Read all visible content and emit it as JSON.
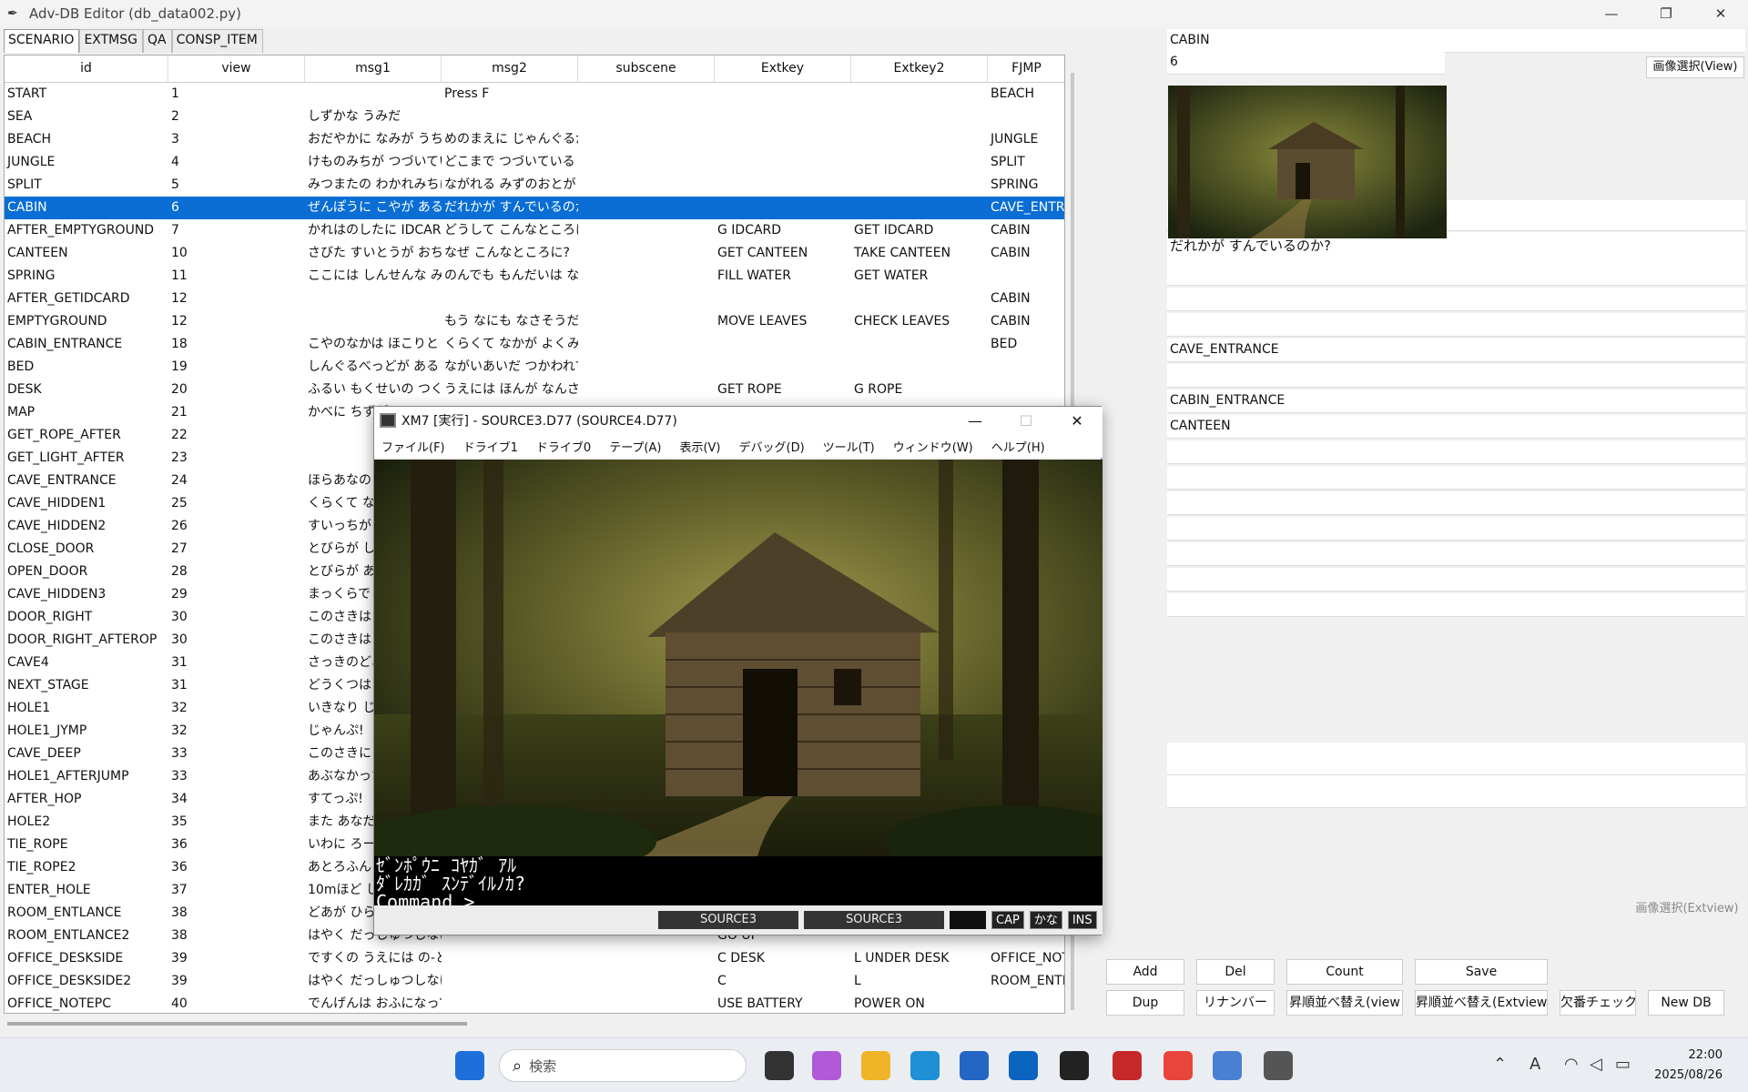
{
  "window": {
    "title": "Adv-DB Editor  (db_data002.py)",
    "minimize": "—",
    "restore": "❐",
    "close": "✕"
  },
  "tabs": [
    "SCENARIO",
    "EXTMSG",
    "QA",
    "CONSP_ITEM"
  ],
  "columns": [
    "id",
    "view",
    "msg1",
    "msg2",
    "subscene",
    "Extkey",
    "Extkey2",
    "FJMP"
  ],
  "rows": [
    [
      "START",
      "1",
      "",
      "Press F",
      "",
      "",
      "",
      "BEACH"
    ],
    [
      "SEA",
      "2",
      "しずかな うみだ",
      "",
      "",
      "",
      "",
      ""
    ],
    [
      "BEACH",
      "3",
      "おだやかに なみが うちよ",
      "めのまえに じゃんぐるが",
      "",
      "",
      "",
      "JUNGLE"
    ],
    [
      "JUNGLE",
      "4",
      "けものみちが つづいてい",
      "どこまで つづいている の",
      "",
      "",
      "",
      "SPLIT"
    ],
    [
      "SPLIT",
      "5",
      "みつまたの わかれみちに",
      "ながれる みずのおとが き",
      "",
      "",
      "",
      "SPRING"
    ],
    [
      "CABIN",
      "6",
      "ぜんぽうに こやが ある",
      "だれかが すんでいるのか",
      "",
      "",
      "",
      "CAVE_ENTRANCE"
    ],
    [
      "AFTER_EMPTYGROUND",
      "7",
      "かれはのしたに IDCARD",
      "どうして こんなところに こ",
      "",
      "G IDCARD",
      "GET IDCARD",
      "CABIN"
    ],
    [
      "CANTEEN",
      "10",
      "さびた すいとうが おちて",
      "なぜ こんなところに?",
      "",
      "GET CANTEEN",
      "TAKE CANTEEN",
      "CABIN"
    ],
    [
      "SPRING",
      "11",
      "ここには しんせんな みず",
      "のんでも もんだいは なさ",
      "",
      "FILL WATER",
      "GET WATER",
      ""
    ],
    [
      "AFTER_GETIDCARD",
      "12",
      "",
      "",
      "",
      "",
      "",
      "CABIN"
    ],
    [
      "EMPTYGROUND",
      "12",
      "",
      "もう なにも なさそうだ",
      "",
      "MOVE LEAVES",
      "CHECK LEAVES",
      "CABIN"
    ],
    [
      "CABIN_ENTRANCE",
      "18",
      "こやのなかは ほこりと か",
      "くらくて なかが よくみえな",
      "",
      "",
      "",
      "BED"
    ],
    [
      "BED",
      "19",
      "しんぐるべっどが ある",
      "ながいあいだ つかわれて",
      "",
      "",
      "",
      ""
    ],
    [
      "DESK",
      "20",
      "ふるい もくせいの つくえ",
      "うえには ほんが なんさつ",
      "",
      "GET ROPE",
      "G ROPE",
      ""
    ],
    [
      "MAP",
      "21",
      "かべに ちずが",
      "",
      "",
      "",
      "",
      ""
    ],
    [
      "GET_ROPE_AFTER",
      "22",
      "",
      "",
      "",
      "",
      "",
      ""
    ],
    [
      "GET_LIGHT_AFTER",
      "23",
      "",
      "",
      "",
      "",
      "",
      ""
    ],
    [
      "CAVE_ENTRANCE",
      "24",
      "ほらあなの い",
      "",
      "",
      "",
      "",
      ""
    ],
    [
      "CAVE_HIDDEN1",
      "25",
      "くらくて なかが",
      "",
      "",
      "",
      "",
      ""
    ],
    [
      "CAVE_HIDDEN2",
      "26",
      "すいっちが あ",
      "",
      "",
      "",
      "",
      ""
    ],
    [
      "CLOSE_DOOR",
      "27",
      "とびらが しま",
      "",
      "",
      "",
      "",
      ""
    ],
    [
      "OPEN_DOOR",
      "28",
      "とびらが あい",
      "",
      "",
      "",
      "",
      ""
    ],
    [
      "CAVE_HIDDEN3",
      "29",
      "まっくらで これ",
      "",
      "",
      "",
      "",
      ""
    ],
    [
      "DOOR_RIGHT",
      "30",
      "このさきは ゆ",
      "",
      "",
      "",
      "",
      ""
    ],
    [
      "DOOR_RIGHT_AFTEROP",
      "30",
      "このさきは ゆ",
      "",
      "",
      "",
      "",
      ""
    ],
    [
      "CAVE4",
      "31",
      "さっきのどあか",
      "",
      "",
      "",
      "",
      ""
    ],
    [
      "NEXT_STAGE",
      "31",
      "どうくつは また",
      "",
      "",
      "",
      "",
      ""
    ],
    [
      "HOLE1",
      "32",
      "いきなり じめ",
      "",
      "",
      "",
      "",
      ""
    ],
    [
      "HOLE1_JYMP",
      "32",
      "じゃんぷ!",
      "",
      "",
      "",
      "",
      ""
    ],
    [
      "CAVE_DEEP",
      "33",
      "このさきに ち",
      "",
      "",
      "",
      "",
      ""
    ],
    [
      "HOLE1_AFTERJUMP",
      "33",
      "あぶなかった",
      "",
      "",
      "",
      "",
      ""
    ],
    [
      "AFTER_HOP",
      "34",
      "すてっぷ!",
      "",
      "",
      "",
      "",
      ""
    ],
    [
      "HOLE2",
      "35",
      "また あなだ。",
      "",
      "",
      "",
      "",
      ""
    ],
    [
      "TIE_ROPE",
      "36",
      "いわに ろーぷ",
      "",
      "",
      "",
      "",
      ""
    ],
    [
      "TIE_ROPE2",
      "36",
      "あとろふん",
      "",
      "",
      "",
      "",
      ""
    ],
    [
      "ENTER_HOLE",
      "37",
      "10mほど した",
      "",
      "",
      "",
      "",
      ""
    ],
    [
      "ROOM_ENTLANCE",
      "38",
      "どあが ひらい",
      "",
      "",
      "",
      "",
      ""
    ],
    [
      "ROOM_ENTLANCE2",
      "38",
      "はやく だっしゅつしなけれ",
      "",
      "",
      "GO UP",
      "",
      ""
    ],
    [
      "OFFICE_DESKSIDE",
      "39",
      "ですくの うえには の-とは",
      "",
      "",
      "C DESK",
      "L UNDER DESK",
      "OFFICE_NOTE"
    ],
    [
      "OFFICE_DESKSIDE2",
      "39",
      "はやく だっしゅつしなけれ",
      "",
      "",
      "C",
      "L",
      "ROOM_ENTI"
    ],
    [
      "OFFICE_NOTEPC",
      "40",
      "でんげんは おふになってい",
      "",
      "",
      "USE BATTERY",
      "POWER ON",
      ""
    ]
  ],
  "fields": [
    {
      "label": "id",
      "value": "CABIN"
    },
    {
      "label": "view",
      "value": "6"
    },
    {
      "label": "msg1",
      "value": "ぜんぽうに こやが ある"
    },
    {
      "label": "msg2",
      "value": "だれかが すんでいるのか?"
    },
    {
      "label": "subscene",
      "value": ""
    },
    {
      "label": "Extkey",
      "value": ""
    },
    {
      "label": "Extkey2",
      "value": ""
    },
    {
      "label": "FJMP",
      "value": "CAVE_ENTRANCE"
    },
    {
      "label": "LJMP",
      "value": ""
    },
    {
      "label": "RJMP",
      "value": "CABIN_ENTRANCE"
    },
    {
      "label": "BJMP",
      "value": "CANTEEN"
    },
    {
      "label": "ExtJMP",
      "value": ""
    },
    {
      "label": "Newscene",
      "value": ""
    },
    {
      "label": "ofset",
      "value": ""
    },
    {
      "label": "NewJMP",
      "value": ""
    },
    {
      "label": "item",
      "value": ""
    },
    {
      "label": "ChJMP",
      "value": ""
    },
    {
      "label": "Useitem",
      "value": ""
    },
    {
      "label": "scene",
      "value": ""
    },
    {
      "label": "write_scene",
      "value": ""
    },
    {
      "label": "QA",
      "value": ""
    },
    {
      "label": "keywd",
      "value": ""
    },
    {
      "label": "keywd2",
      "value": ""
    },
    {
      "label": "Aword1",
      "value": ""
    },
    {
      "label": "Aword2",
      "value": ""
    },
    {
      "label": "Extview",
      "value": ""
    },
    {
      "label": "consp",
      "value": ""
    }
  ],
  "image_select_view": "画像選択(View)",
  "image_select_extview": "画像選択(Extview)",
  "buttons_row1": [
    "Add",
    "Del",
    "Count",
    "Save"
  ],
  "buttons_row2": [
    "Dup",
    "リナンバー",
    "昇順並べ替え(view",
    "昇順並べ替え(Extview",
    "欠番チェック",
    "New DB"
  ],
  "xm7": {
    "title": "XM7 [実行] - SOURCE3.D77 (SOURCE4.D77)",
    "menu": [
      "ファイル(F)",
      "ドライブ1",
      "ドライブ0",
      "テープ(A)",
      "表示(V)",
      "デバッグ(D)",
      "ツール(T)",
      "ウィンドウ(W)",
      "ヘルプ(H)"
    ],
    "console": [
      "ｾﾞﾝﾎﾟｳﾆ ｺﾔｶﾞ ｱﾙ",
      "ﾀﾞﾚｶｶﾞ ｽﾝﾃﾞｲﾙﾉｶ?",
      "Command >_"
    ],
    "drive1": "SOURCE3",
    "drive0": "SOURCE3",
    "flags": [
      "CAP",
      "かな",
      "INS"
    ],
    "minimize": "—",
    "maximize": "☐",
    "close": "✕"
  },
  "taskbar": {
    "search_placeholder": "検索",
    "time": "22:00",
    "date": "2025/08/26"
  },
  "colors": {
    "selection": "#0a6ed4",
    "window_bg": "#f0f0f0"
  }
}
